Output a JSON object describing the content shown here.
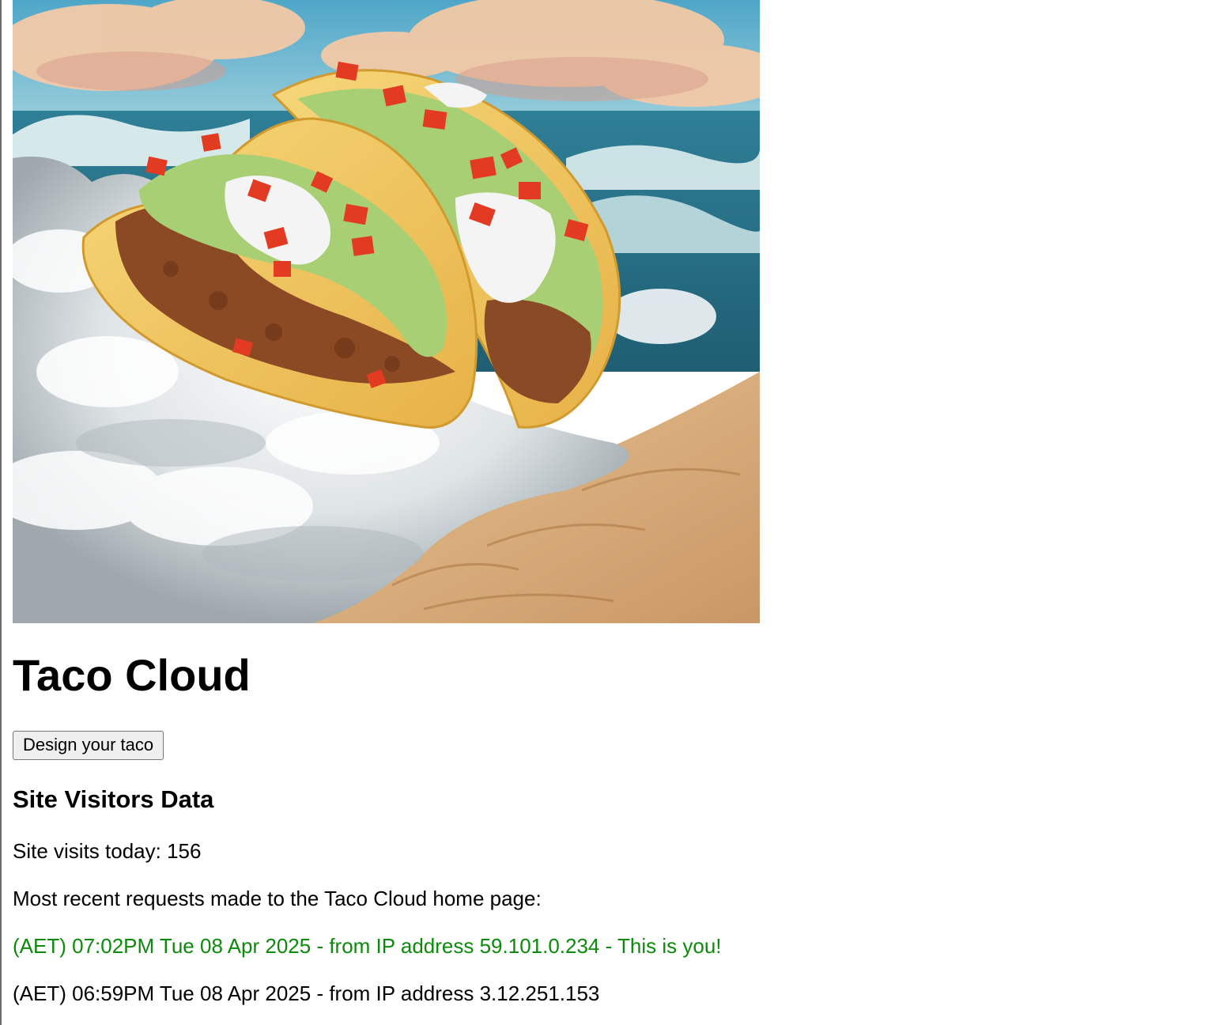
{
  "hero": {
    "alt": "Two tacos floating on a cloud over ocean waves"
  },
  "header": {
    "title": "Taco Cloud"
  },
  "actions": {
    "design_button_label": "Design your taco"
  },
  "visitors": {
    "section_title": "Site Visitors Data",
    "visits_today_text": "Site visits today: 156",
    "recent_requests_label": "Most recent requests made to the Taco Cloud home page:",
    "requests": [
      {
        "text": "(AET) 07:02PM Tue 08 Apr 2025 - from IP address 59.101.0.234 - This is you!",
        "is_you": true
      },
      {
        "text": "(AET) 06:59PM Tue 08 Apr 2025 - from IP address 3.12.251.153",
        "is_you": false
      }
    ]
  },
  "colors": {
    "current_user": "#0b8a0b",
    "text": "#000000",
    "background": "#ffffff",
    "button_bg": "#efefef"
  }
}
